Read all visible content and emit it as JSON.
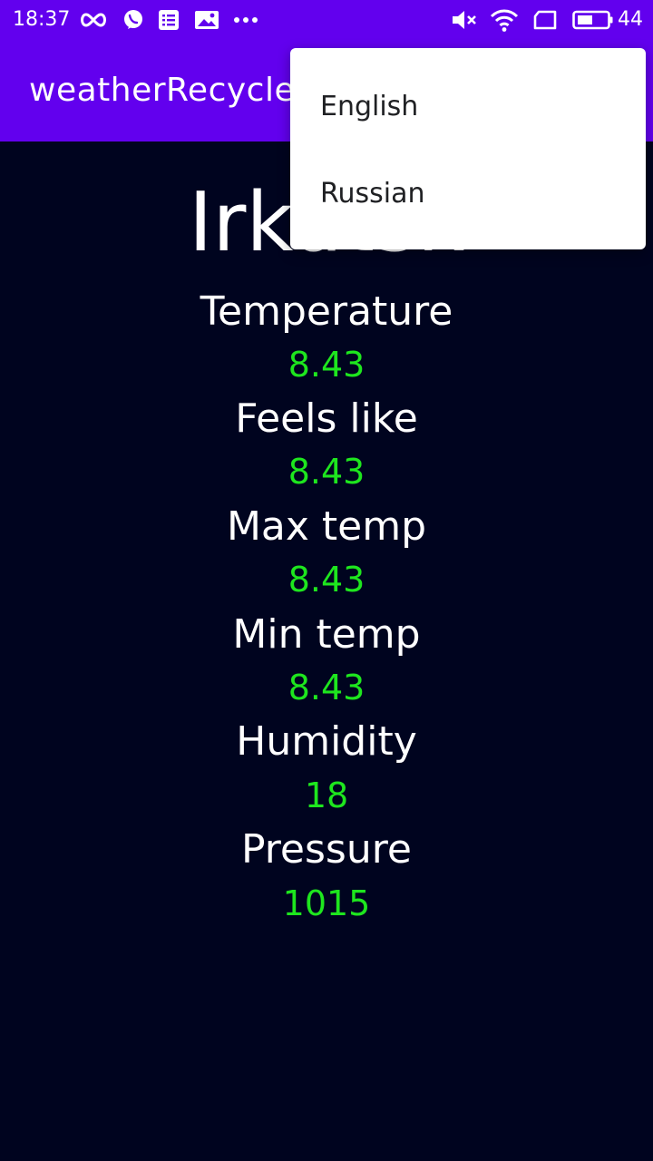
{
  "status_bar": {
    "time": "18:37",
    "battery_level": "44",
    "icons": [
      "infinity-icon",
      "viber-icon",
      "list-icon",
      "gallery-icon",
      "more-dots-icon",
      "mute-icon",
      "wifi-icon",
      "screen-icon",
      "battery-icon"
    ]
  },
  "app_bar": {
    "title": "weatherRecycler"
  },
  "weather": {
    "city": "Irkutsk",
    "rows": [
      {
        "label": "Temperature",
        "value": "8.43"
      },
      {
        "label": "Feels like",
        "value": "8.43"
      },
      {
        "label": "Max temp",
        "value": "8.43"
      },
      {
        "label": "Min temp",
        "value": "8.43"
      },
      {
        "label": "Humidity",
        "value": "18"
      },
      {
        "label": "Pressure",
        "value": "1015"
      }
    ]
  },
  "language_menu": {
    "items": [
      "English",
      "Russian"
    ]
  },
  "colors": {
    "primary": "#6200ee",
    "background": "#00041f",
    "value_text": "#1ee61e",
    "label_text": "#ffffff"
  }
}
